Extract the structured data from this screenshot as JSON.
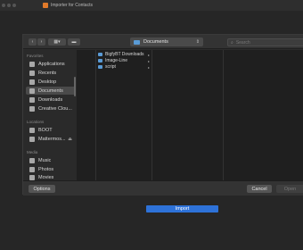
{
  "app": {
    "title": "Importer for Contacts"
  },
  "dialog": {
    "toolbar": {
      "back_glyph": "‹",
      "forward_glyph": "›",
      "view_glyph": "▦▾",
      "new_folder_glyph": "▬",
      "location": "Documents",
      "location_caret": "⇕",
      "search_placeholder": "Search",
      "search_glyph": "⌕"
    },
    "sidebar": {
      "favorites_heading": "Favorites",
      "favorites": [
        {
          "label": "Applications",
          "icon": "applications-icon"
        },
        {
          "label": "Recents",
          "icon": "recents-icon"
        },
        {
          "label": "Desktop",
          "icon": "desktop-icon"
        },
        {
          "label": "Documents",
          "icon": "documents-icon",
          "selected": true
        },
        {
          "label": "Downloads",
          "icon": "downloads-icon"
        },
        {
          "label": "Creative Clou...",
          "icon": "creative-cloud-icon"
        }
      ],
      "locations_heading": "Locations",
      "locations": [
        {
          "label": "BOOT",
          "icon": "disk-icon"
        },
        {
          "label": "Mattermos...",
          "icon": "disk-icon",
          "eject": "⏏"
        }
      ],
      "media_heading": "Media",
      "media": [
        {
          "label": "Music",
          "icon": "music-icon"
        },
        {
          "label": "Photos",
          "icon": "photos-icon"
        },
        {
          "label": "Movies",
          "icon": "movies-icon"
        }
      ]
    },
    "files": [
      {
        "name": "BigfyBT Downloads",
        "arrow": "▸"
      },
      {
        "name": "Image-Line",
        "arrow": "▸"
      },
      {
        "name": "script",
        "arrow": "▸"
      }
    ],
    "footer": {
      "options_label": "Options",
      "cancel_label": "Cancel",
      "open_label": "Open"
    }
  },
  "import_button": {
    "label": "Import"
  },
  "colors": {
    "accent": "#2e72d8",
    "folder": "#5a9bd6",
    "app_icon": "#e07a2a"
  }
}
